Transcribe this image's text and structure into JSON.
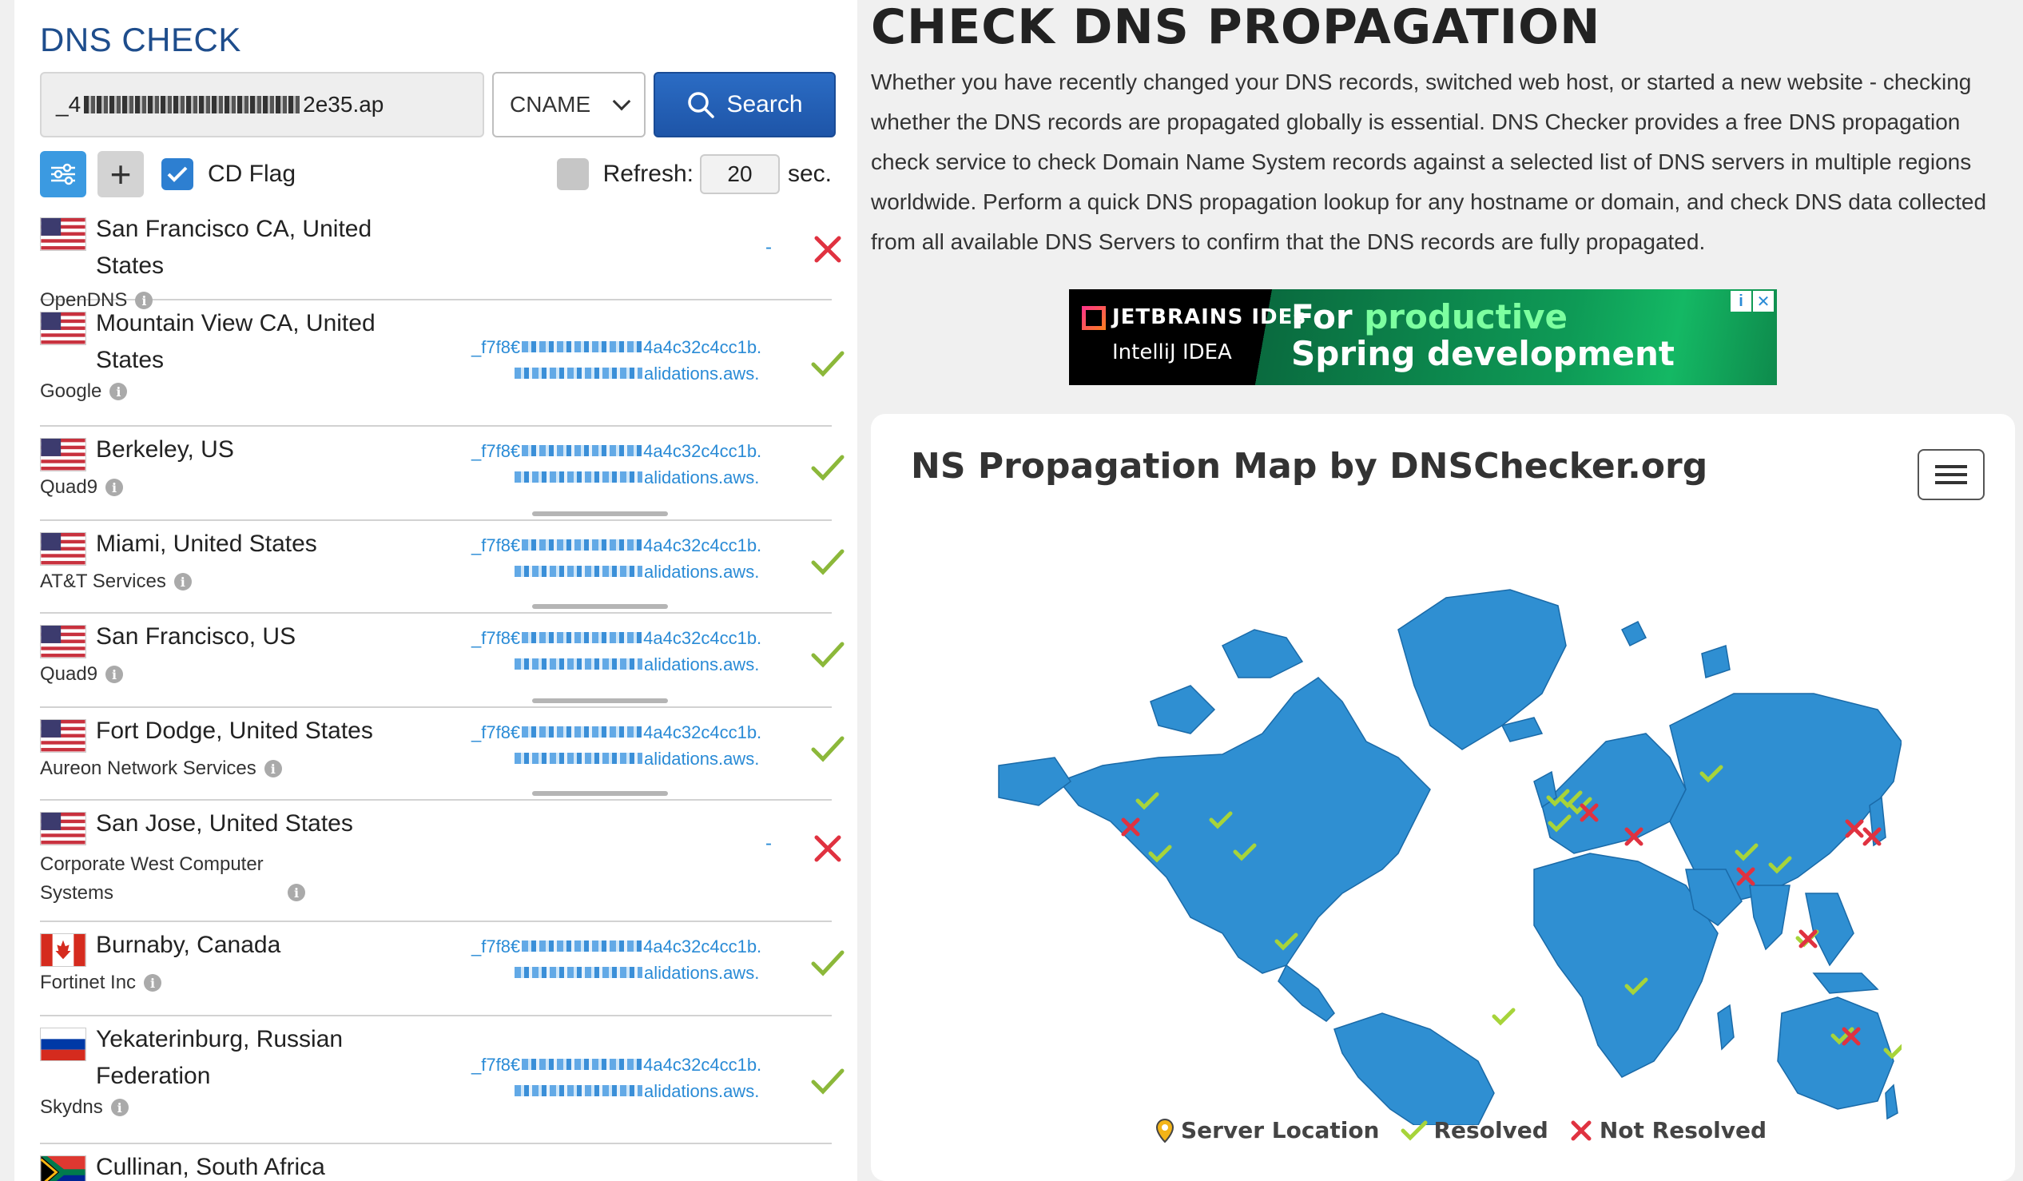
{
  "brand": "DNS CHECK",
  "search": {
    "domain_prefix": "_4",
    "domain_suffix": "2e35.ap",
    "record_type": "CNAME",
    "button_label": "Search"
  },
  "options": {
    "cd_flag_label": "CD Flag",
    "cd_flag_checked": true,
    "refresh_label": "Refresh:",
    "refresh_value": "20",
    "refresh_unit": "sec."
  },
  "results": [
    {
      "flag": "us",
      "location": "San Francisco CA, United States",
      "provider": "OpenDNS",
      "value1": "",
      "value2": "",
      "status": "fail"
    },
    {
      "flag": "us",
      "location": "Mountain View CA, United States",
      "provider": "Google",
      "value1_start": "_f7f8€",
      "value1_end": "4a4c32c4cc1b.",
      "value2_end": "alidations.aws.",
      "status": "ok"
    },
    {
      "flag": "us",
      "location": "Berkeley, US",
      "provider": "Quad9",
      "value1_start": "_f7f8€",
      "value1_end": "4a4c32c4cc1b.",
      "value2_end": "alidations.aws.",
      "status": "ok"
    },
    {
      "flag": "us",
      "location": "Miami, United States",
      "provider": "AT&T Services",
      "value1_start": "_f7f8€",
      "value1_end": "4a4c32c4cc1b.",
      "value2_end": "alidations.aws.",
      "status": "ok"
    },
    {
      "flag": "us",
      "location": "San Francisco, US",
      "provider": "Quad9",
      "value1_start": "_f7f8€",
      "value1_end": "4a4c32c4cc1b.",
      "value2_end": "alidations.aws.",
      "status": "ok"
    },
    {
      "flag": "us",
      "location": "Fort Dodge, United States",
      "provider": "Aureon Network Services",
      "value1_start": "_f7f8€",
      "value1_end": "4a4c32c4cc1b.",
      "value2_end": "alidations.aws.",
      "status": "ok"
    },
    {
      "flag": "us",
      "location": "San Jose, United States",
      "provider": "Corporate West Computer Systems",
      "value1": "",
      "value2": "",
      "status": "fail"
    },
    {
      "flag": "ca",
      "location": "Burnaby, Canada",
      "provider": "Fortinet Inc",
      "value1_start": "_f7f8€",
      "value1_end": "4a4c32c4cc1b.",
      "value2_end": "alidations.aws.",
      "status": "ok"
    },
    {
      "flag": "ru",
      "location": "Yekaterinburg, Russian Federation",
      "provider": "Skydns",
      "value1_start": "_f7f8€",
      "value1_end": "4a4c32c4cc1b.",
      "value2_end": "alidations.aws.",
      "status": "ok"
    },
    {
      "flag": "za",
      "location": "Cullinan, South Africa",
      "provider": "",
      "status": ""
    }
  ],
  "right": {
    "heading": "CHECK DNS PROPAGATION",
    "description": "Whether you have recently changed your DNS records, switched web host, or started a new website - checking whether the DNS records are propagated globally is essential. DNS Checker provides a free DNS propagation check service to check Domain Name System records against a selected list of DNS servers in multiple regions worldwide. Perform a quick DNS propagation lookup for any hostname or domain, and check DNS data collected from all available DNS Servers to confirm that the DNS records are fully propagated."
  },
  "ad": {
    "brand": "JETBRAINS IDEs",
    "product": "IntelliJ IDEA",
    "tagline_1a": "For ",
    "tagline_1b": "productive",
    "tagline_2": "Spring development"
  },
  "map": {
    "title": "NS Propagation Map by DNSChecker.org",
    "legend_server": "Server Location",
    "legend_resolved": "Resolved",
    "legend_not_resolved": "Not Resolved"
  },
  "colors": {
    "brand": "#1e4d8c",
    "button": "#1e55a8",
    "link": "#2a8bd6",
    "ok": "#8cb83a",
    "fail": "#e03240",
    "land": "#2f8fd2"
  }
}
